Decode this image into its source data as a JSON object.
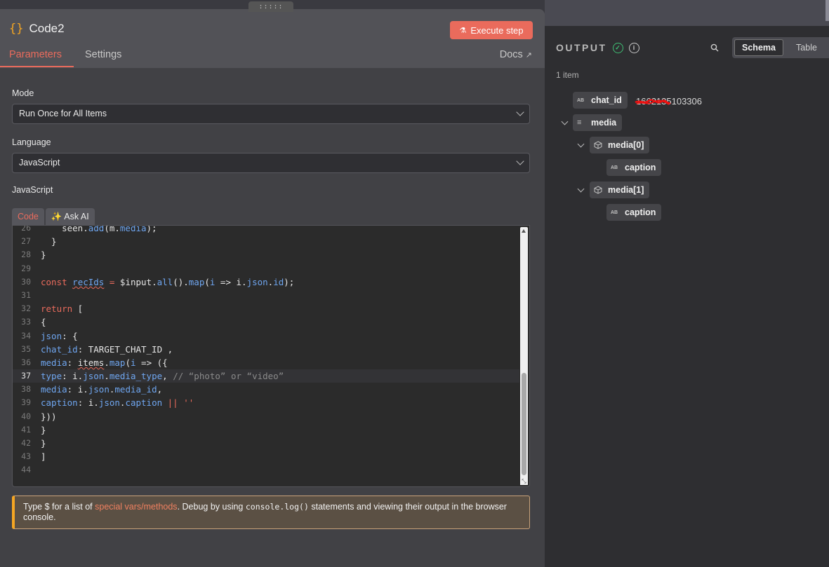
{
  "node": {
    "title": "Code2",
    "execute_label": "Execute step",
    "tabs": [
      {
        "label": "Parameters"
      },
      {
        "label": "Settings"
      }
    ],
    "docs_label": "Docs",
    "drag_handle": ":::::"
  },
  "params": {
    "mode_label": "Mode",
    "mode_value": "Run Once for All Items",
    "language_label": "Language",
    "language_value": "JavaScript",
    "code_label": "JavaScript",
    "code_tab": "Code",
    "ask_ai_tab": "✨ Ask AI"
  },
  "editor": {
    "current_line": 37,
    "scroll_position": 0.72
  },
  "hint": {
    "part1": "Type $ for a list of ",
    "link": "special vars/methods",
    "part2": ". Debug by using ",
    "code": "console.log()",
    "part3": " statements and viewing their output in the browser console."
  },
  "output": {
    "title": "OUTPUT",
    "view_selected": "Schema",
    "view_other": "Table",
    "item_count": "1 item",
    "fields": {
      "chat_id": {
        "name": "chat_id",
        "type": "AB",
        "value": "1662135103306"
      },
      "media": {
        "name": "media",
        "type": "≡"
      },
      "media0": {
        "name": "media[0]"
      },
      "media1": {
        "name": "media[1]"
      },
      "caption0": {
        "name": "caption",
        "type": "AB"
      },
      "caption1": {
        "name": "caption",
        "type": "AB"
      }
    }
  },
  "colors": {
    "accent": "#ea6b5c",
    "success": "#3fbf74",
    "warning": "#f5a623"
  }
}
